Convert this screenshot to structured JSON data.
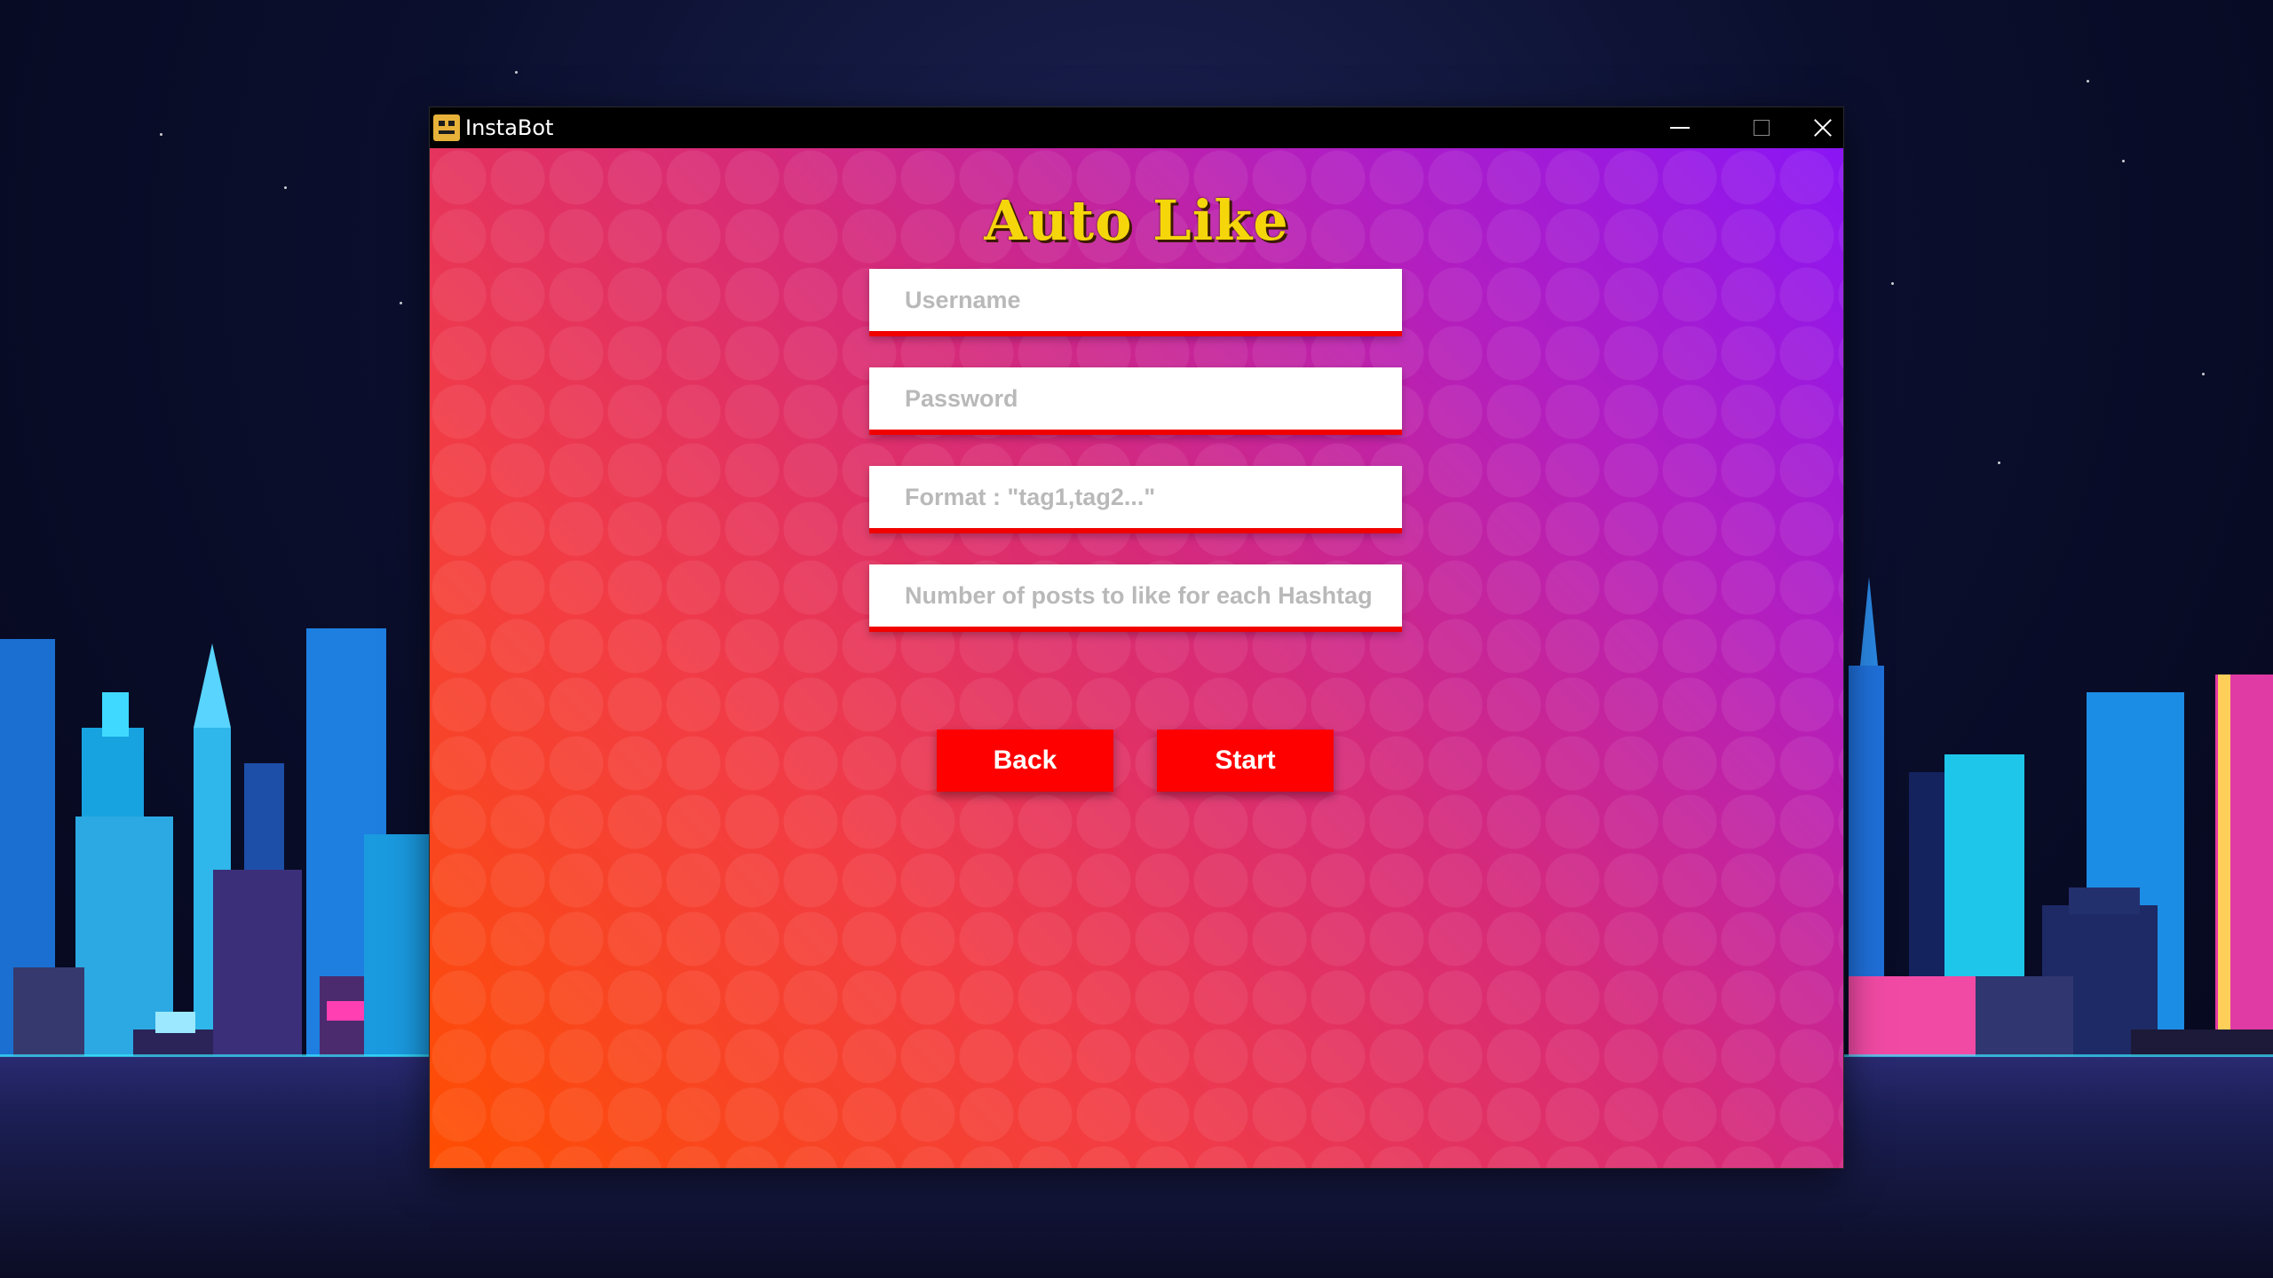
{
  "window": {
    "title": "InstaBot"
  },
  "screen": {
    "heading": "Auto Like",
    "fields": {
      "username": {
        "value": "",
        "placeholder": "Username"
      },
      "password": {
        "value": "",
        "placeholder": "Password"
      },
      "hashtags": {
        "value": "",
        "placeholder": "Format : \"tag1,tag2...\""
      },
      "post_count": {
        "value": "",
        "placeholder": "Number of posts to like for each Hashtag"
      }
    },
    "buttons": {
      "back": "Back",
      "start": "Start"
    }
  },
  "colors": {
    "heading": "#f5d60b",
    "button": "#ff0000",
    "field_underline": "#f10000",
    "gradient_start": "#ff4e00",
    "gradient_end": "#8a16f5"
  },
  "icons": {
    "app": "robot-face-icon",
    "minimize": "minimize-icon",
    "maximize": "maximize-icon",
    "close": "close-icon"
  }
}
